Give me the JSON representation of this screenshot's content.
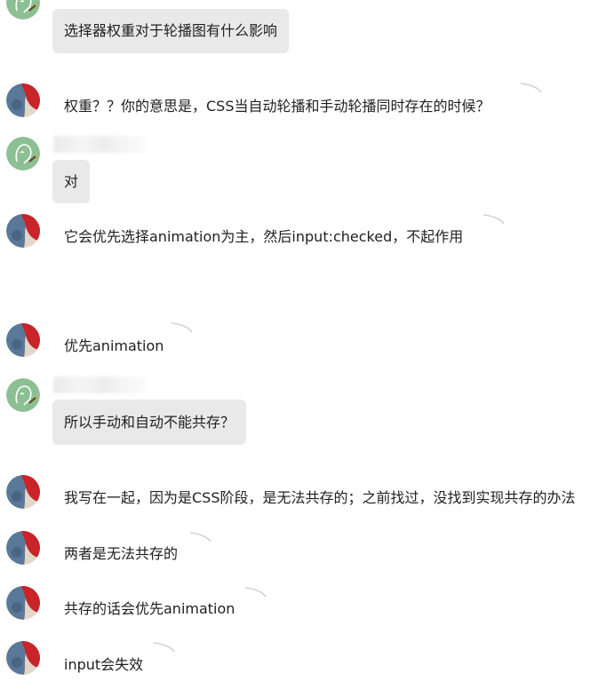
{
  "chat": {
    "messages": [
      {
        "sender": "other",
        "text": "选择器权重对于轮播图有什么影响"
      },
      {
        "sender": "self",
        "text": "权重？？你的意思是，CSS当自动轮播和手动轮播同时存在的时候？"
      },
      {
        "sender": "other",
        "text": "对"
      },
      {
        "sender": "self",
        "text": "它会优先选择animation为主，然后input:checked，不起作用"
      },
      {
        "sender": "self",
        "text": "优先animation"
      },
      {
        "sender": "other",
        "text": "所以手动和自动不能共存？"
      },
      {
        "sender": "self",
        "text": "我写在一起，因为是CSS阶段，是无法共存的；之前找过，没找到实现共存的办法"
      },
      {
        "sender": "self",
        "text": "两者是无法共存的"
      },
      {
        "sender": "self",
        "text": "共存的话会优先animation"
      },
      {
        "sender": "self",
        "text": "input会失效"
      }
    ]
  },
  "colors": {
    "other_bubble": "#e9e9e9",
    "self_bubble": "#ffffff",
    "avatar_other": "#8cbf94",
    "avatar_self_red": "#c8242a",
    "avatar_self_blue": "#5a7897"
  },
  "icons": {
    "other_avatar": "sketch-face-avatar-icon",
    "self_avatar": "red-blue-avatar-icon"
  }
}
